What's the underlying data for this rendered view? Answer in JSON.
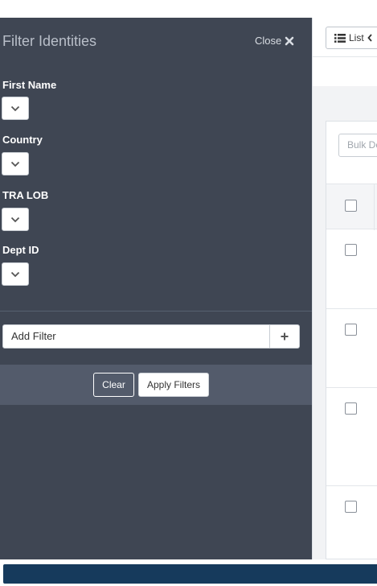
{
  "filter_panel": {
    "title": "Filter Identities",
    "close_label": "Close",
    "fields": [
      {
        "label": "First Name"
      },
      {
        "label": "Country"
      },
      {
        "label": "TRA LOB"
      },
      {
        "label": "Dept ID"
      }
    ],
    "add_filter_label": "Add Filter",
    "clear_label": "Clear",
    "apply_label": "Apply Filters"
  },
  "content": {
    "view_button_label": "List",
    "bulk_input_placeholder": "Bulk De"
  },
  "colors": {
    "panel_bg": "#3f4653",
    "actions_bar_bg": "#535b6b",
    "bottom_bar_bg": "#163a5c"
  }
}
